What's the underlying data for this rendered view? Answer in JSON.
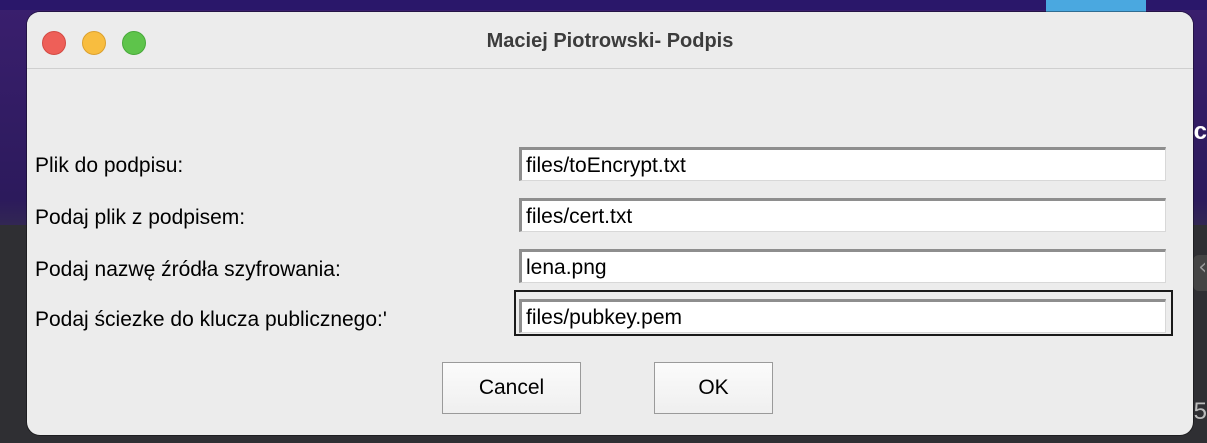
{
  "window": {
    "title": "Maciej Piotrowski- Podpis"
  },
  "form": {
    "rows": [
      {
        "label": "Plik do podpisu:",
        "value": "files/toEncrypt.txt"
      },
      {
        "label": "Podaj plik z podpisem:",
        "value": "files/cert.txt"
      },
      {
        "label": "Podaj nazwę źródła szyfrowania:",
        "value": "lena.png"
      },
      {
        "label": "Podaj ściezke do klucza publicznego:'",
        "value": "files/pubkey.pem"
      }
    ]
  },
  "buttons": {
    "cancel_label": "Cancel",
    "ok_label": "OK"
  },
  "background": {
    "partial_text_right": "c",
    "partial_text_bottom": "5"
  },
  "colors": {
    "close": "#ee5f58",
    "minimize": "#f8bd3f",
    "maximize": "#5ec44b",
    "window_bg": "#ececec"
  }
}
